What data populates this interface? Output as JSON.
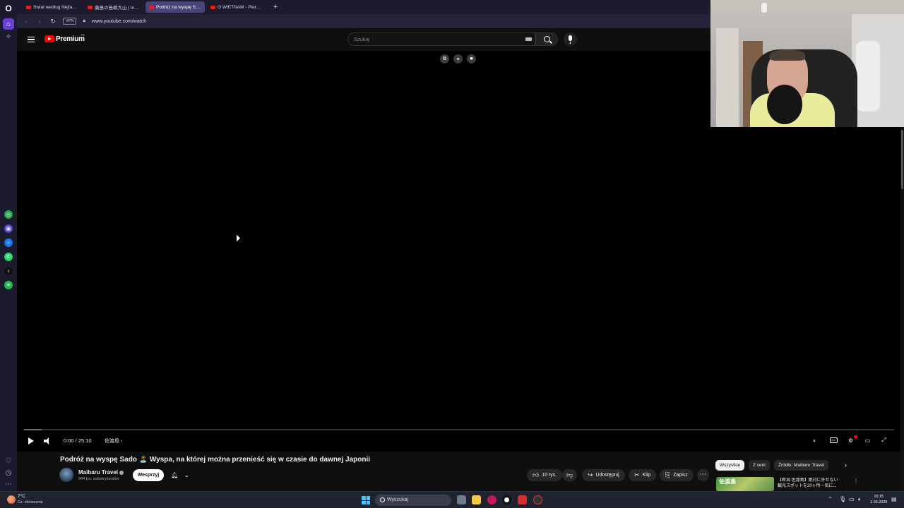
{
  "browser": {
    "tabs": [
      {
        "title": "Świat według Nejtana - Y",
        "icon": "youtube-icon"
      },
      {
        "title": "廣島の島嶼大山 | Insta36",
        "icon": "youtube-icon"
      },
      {
        "title": "Podróż na wyspę Sado 🏝️",
        "icon": "youtube-icon",
        "active": true
      },
      {
        "title": "ʘ WIETNAM - Pierwsze",
        "icon": "youtube-icon"
      }
    ],
    "new_tab": "+",
    "vpn_label": "VPN",
    "url": "www.youtube.com/watch"
  },
  "youtube": {
    "brand": "Premium",
    "country": "PL",
    "search_placeholder": "Szukaj"
  },
  "player": {
    "time": "0:00 / 25:10",
    "chapter": "佐渡島 ›",
    "progress_played": 0.0,
    "progress_loaded": 0.02
  },
  "video": {
    "title": "Podróż na wyspę Sado 🏝️ Wyspa, na której można przenieść się w czasie do dawnej Japonii",
    "channel": "Maibaru Travel",
    "subscribers": "944 tys. subskrybentów",
    "support_label": "Wesprzyj",
    "likes": "10 tys.",
    "share_label": "Udostępnij",
    "clip_label": "Klip",
    "save_label": "Zapisz"
  },
  "recommendations": {
    "chips": [
      "Wszystkie",
      "Z serii",
      "Źródło: Maibaru Travel"
    ],
    "first": {
      "thumb_text": "佐渡島",
      "title_line1": "【新潟 佐渡島】絶対に外せない",
      "title_line2": "観光スポットを20ヶ所一気に..."
    }
  },
  "taskbar": {
    "temperature": "7°C",
    "weather": "Cz. słonecznie",
    "search_label": "Wyszukaj",
    "time": "10:15",
    "date": "1.03.2026"
  },
  "colors": {
    "youtube_red": "#ff0000",
    "opera_sidebar": "#1c1b2e",
    "active_tab": "#49457a",
    "taskbar": "#1f2330"
  }
}
